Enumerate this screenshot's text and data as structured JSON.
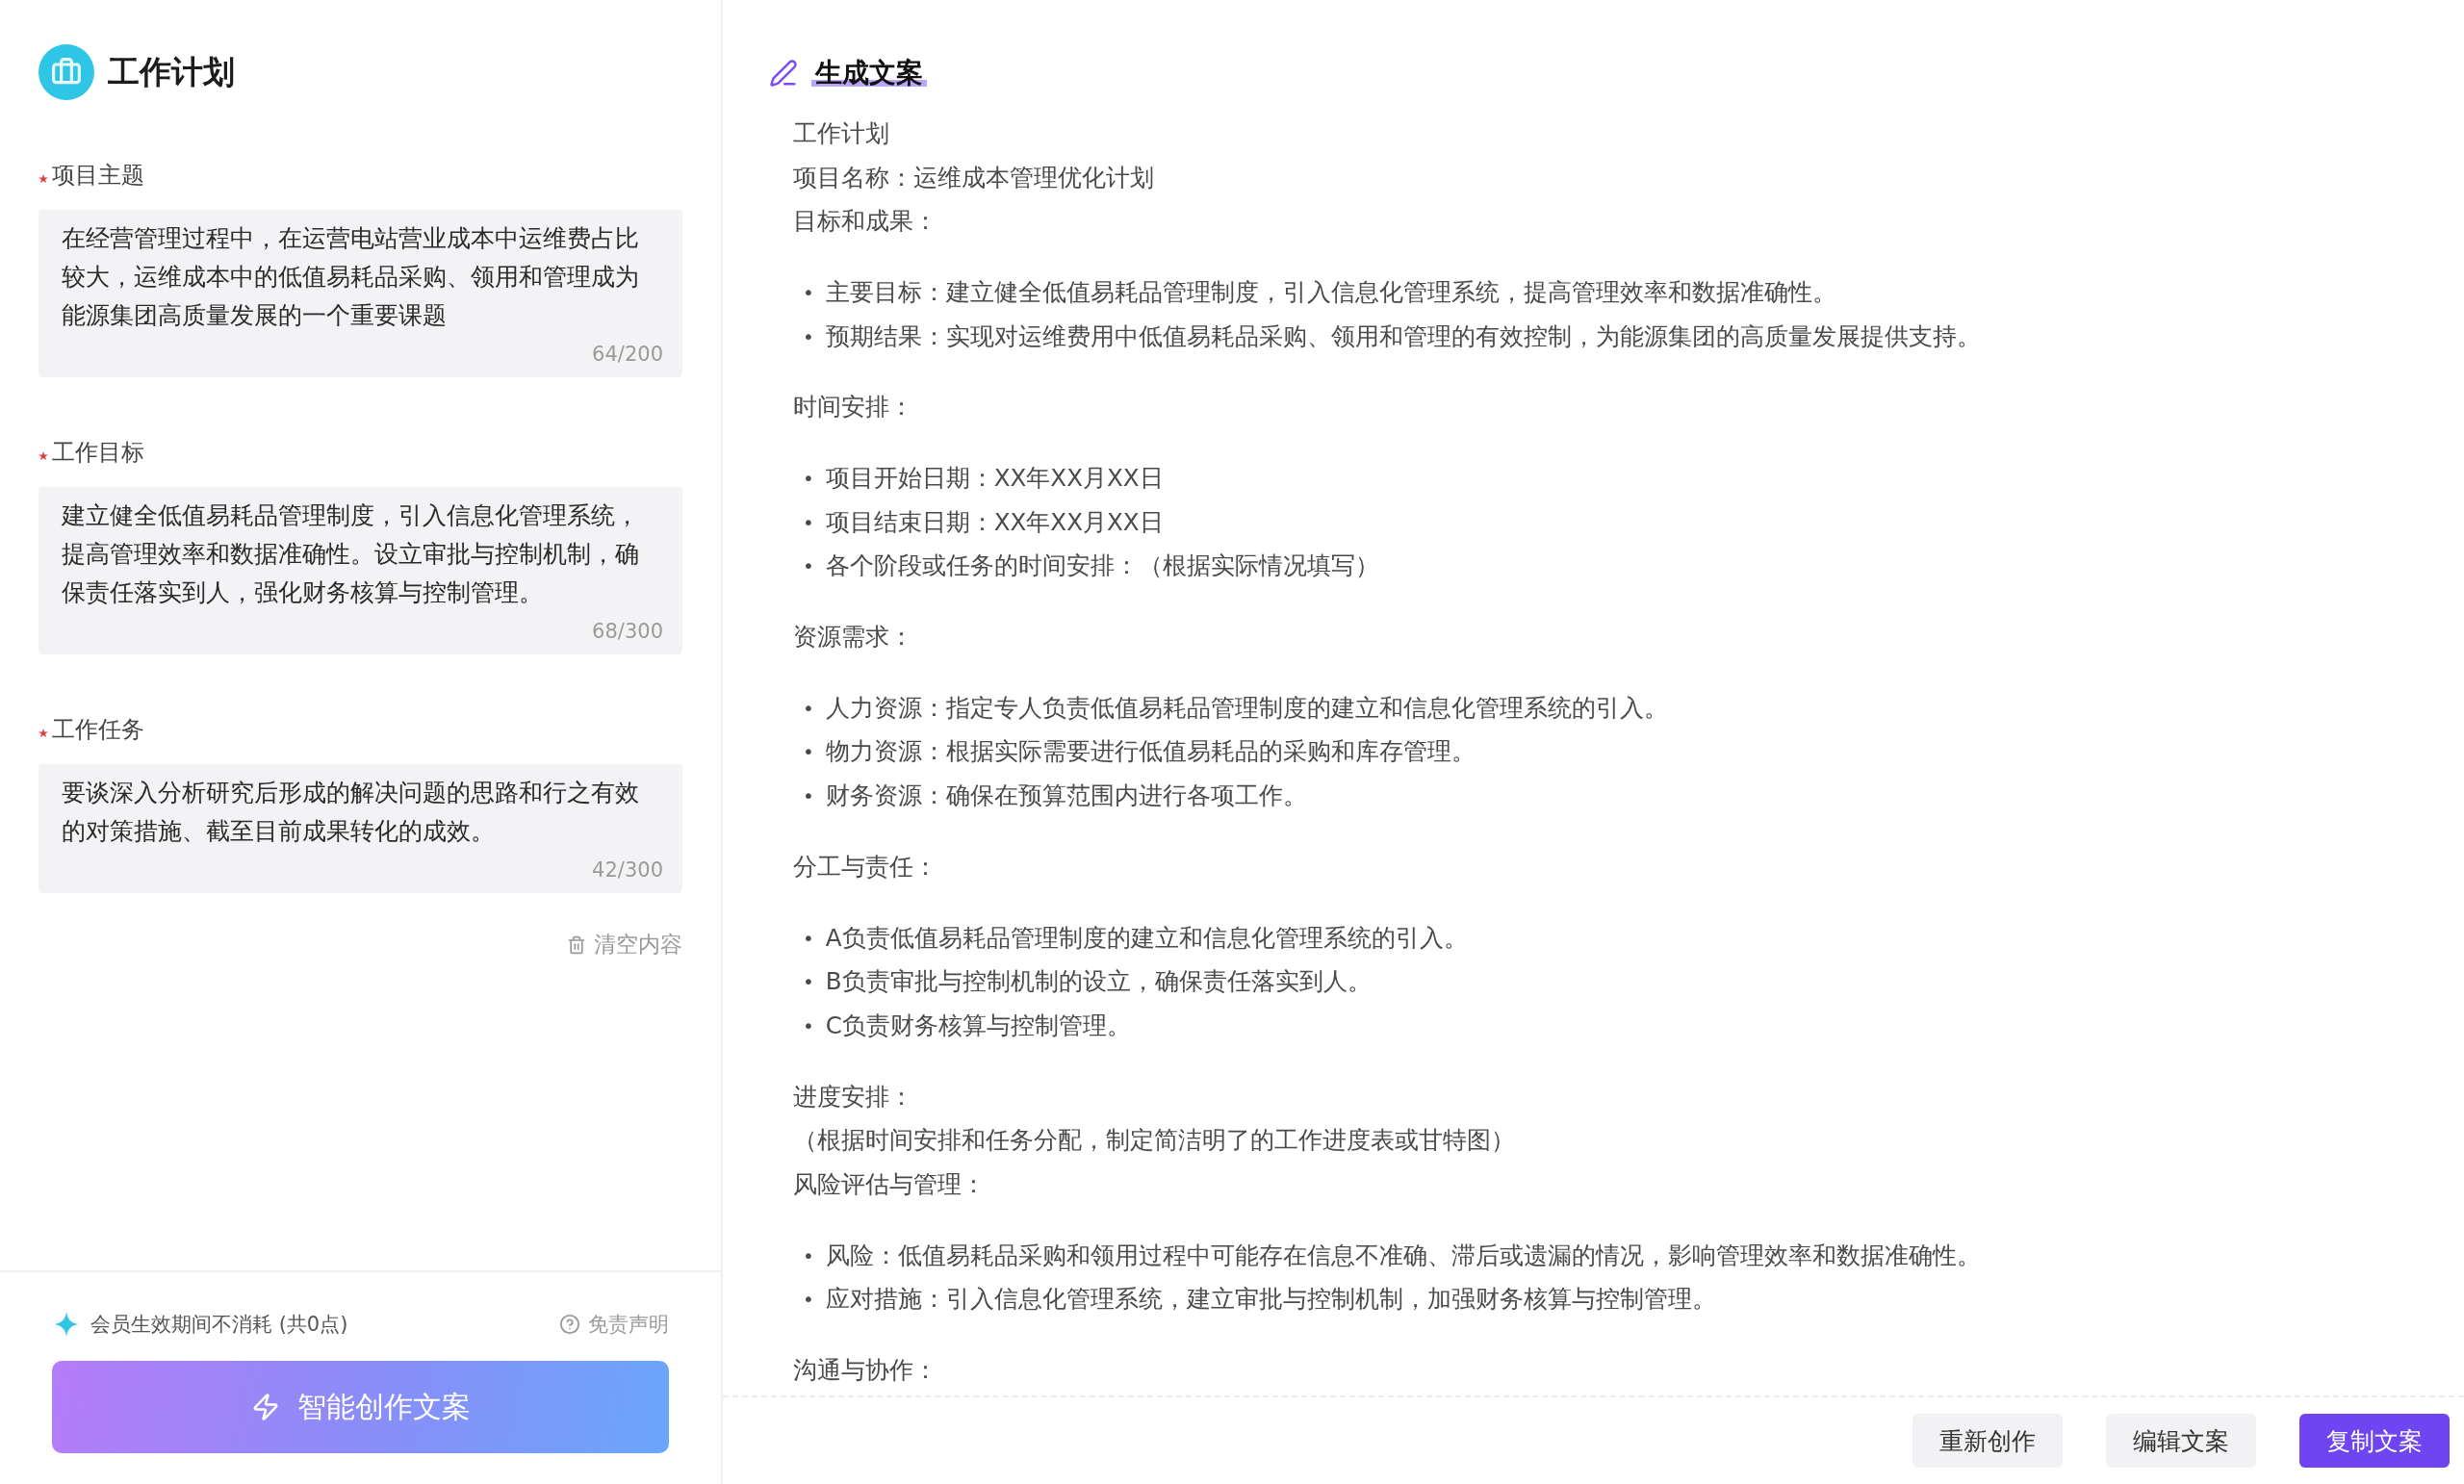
{
  "app": {
    "title": "工作计划"
  },
  "form": {
    "fields": [
      {
        "label": "项目主题",
        "required": true,
        "value": "在经营管理过程中，在运营电站营业成本中运维费占比较大，运维成本中的低值易耗品采购、领用和管理成为能源集团高质量发展的一个重要课题",
        "counter": "64/200"
      },
      {
        "label": "工作目标",
        "required": true,
        "value": "建立健全低值易耗品管理制度，引入信息化管理系统，提高管理效率和数据准确性。设立审批与控制机制，确保责任落实到人，强化财务核算与控制管理。",
        "counter": "68/300"
      },
      {
        "label": "工作任务",
        "required": true,
        "value": "要谈深入分析研究后形成的解决问题的思路和行之有效的对策措施、截至目前成果转化的成效。",
        "counter": "42/300"
      }
    ],
    "clear_button": "清空内容"
  },
  "footer": {
    "note": "会员生效期间不消耗 (共0点)",
    "disclaimer": "免责声明",
    "generate_button": "智能创作文案"
  },
  "output": {
    "title": "生成文案",
    "blocks": [
      {
        "kind": "line",
        "text": "工作计划"
      },
      {
        "kind": "line",
        "text": "项目名称：运维成本管理优化计划"
      },
      {
        "kind": "line",
        "text": "目标和成果："
      },
      {
        "kind": "list",
        "marker": "•",
        "items": [
          "主要目标：建立健全低值易耗品管理制度，引入信息化管理系统，提高管理效率和数据准确性。",
          "预期结果：实现对运维费用中低值易耗品采购、领用和管理的有效控制，为能源集团的高质量发展提供支持。"
        ]
      },
      {
        "kind": "line",
        "text": "时间安排："
      },
      {
        "kind": "list",
        "marker": "•",
        "items": [
          "项目开始日期：XX年XX月XX日",
          "项目结束日期：XX年XX月XX日",
          "各个阶段或任务的时间安排：（根据实际情况填写）"
        ]
      },
      {
        "kind": "line",
        "text": "资源需求："
      },
      {
        "kind": "list",
        "marker": "•",
        "items": [
          "人力资源：指定专人负责低值易耗品管理制度的建立和信息化管理系统的引入。",
          "物力资源：根据实际需要进行低值易耗品的采购和库存管理。",
          "财务资源：确保在预算范围内进行各项工作。"
        ]
      },
      {
        "kind": "line",
        "text": "分工与责任："
      },
      {
        "kind": "list",
        "marker": "•",
        "items": [
          "A负责低值易耗品管理制度的建立和信息化管理系统的引入。",
          "B负责审批与控制机制的设立，确保责任落实到人。",
          "C负责财务核算与控制管理。"
        ]
      },
      {
        "kind": "line",
        "text": "进度安排："
      },
      {
        "kind": "line",
        "text": "（根据时间安排和任务分配，制定简洁明了的工作进度表或甘特图）"
      },
      {
        "kind": "line",
        "text": "风险评估与管理："
      },
      {
        "kind": "list",
        "marker": "•",
        "items": [
          "风险：低值易耗品采购和领用过程中可能存在信息不准确、滞后或遗漏的情况，影响管理效率和数据准确性。",
          "应对措施：引入信息化管理系统，建立审批与控制机制，加强财务核算与控制管理。"
        ]
      },
      {
        "kind": "line",
        "text": "沟通与协作："
      }
    ],
    "actions": [
      {
        "label": "重新创作",
        "primary": false
      },
      {
        "label": "编辑文案",
        "primary": false
      },
      {
        "label": "复制文案",
        "primary": true
      }
    ]
  }
}
